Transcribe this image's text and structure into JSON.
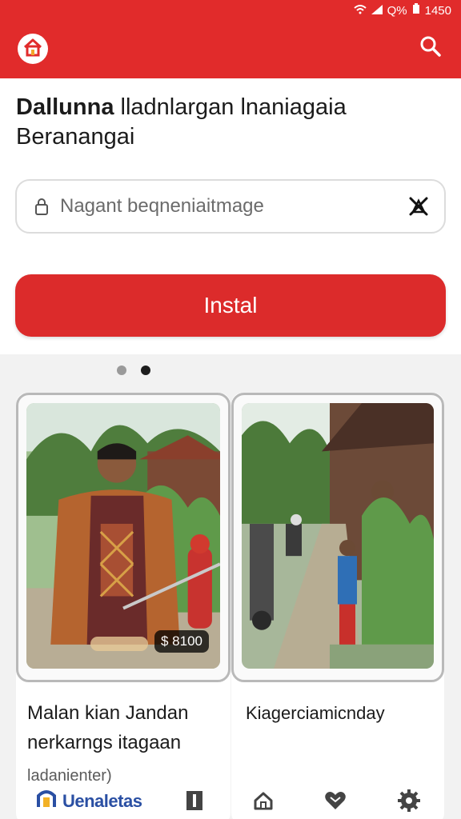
{
  "status_bar": {
    "battery_text": "Q%",
    "time": "1450"
  },
  "app_bar": {
    "home_icon": "home-icon",
    "search_icon": "search-icon",
    "color": "#e12b2b"
  },
  "title": {
    "bold": "Dallunna",
    "rest": " lladnlargan lnaniagaia",
    "line2": "Berananga​i"
  },
  "search": {
    "placeholder": "Nagant beqneniaitmage",
    "value": "Nagant beqneniaitmage"
  },
  "install_button": {
    "label": "Instal"
  },
  "gallery": {
    "dots": [
      "inactive",
      "active"
    ],
    "cards": [
      {
        "caption_line1": "Malan kian Jandan",
        "caption_line2": "nerkarngs itagaan",
        "subtitle": "ladanienter)",
        "badge": "$ 8100"
      },
      {
        "caption_line1": "Kiagerciamicnday"
      }
    ]
  },
  "bottom_nav": {
    "brand": "Uenaletas",
    "items": [
      "bookmark-icon",
      "home-icon",
      "heart-icon",
      "gear-icon"
    ]
  }
}
